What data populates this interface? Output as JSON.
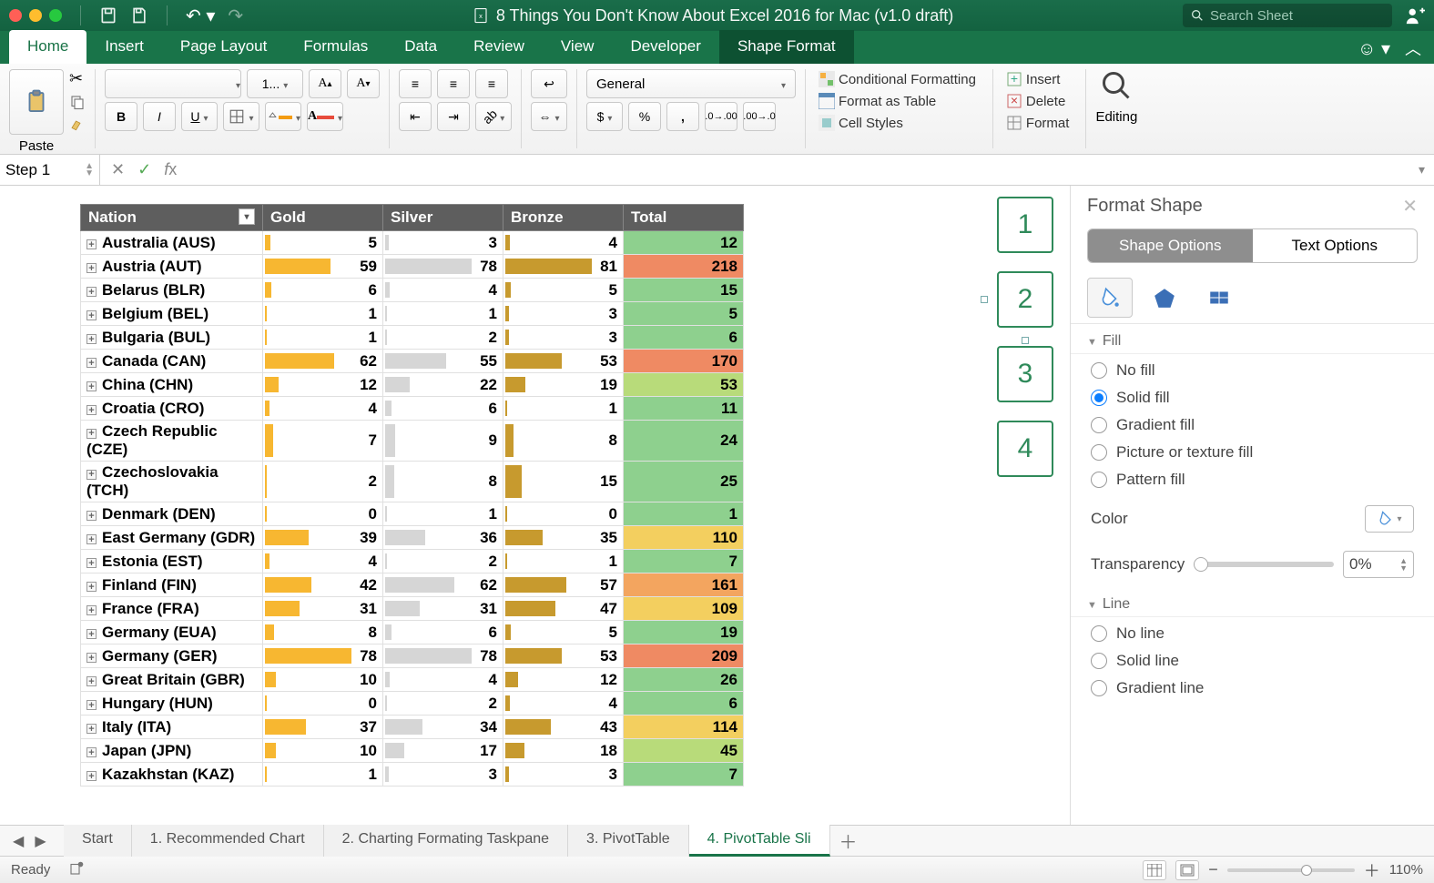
{
  "title": "8 Things You Don't Know About Excel 2016 for Mac (v1.0 draft)",
  "search_placeholder": "Search Sheet",
  "tabs": [
    "Home",
    "Insert",
    "Page Layout",
    "Formulas",
    "Data",
    "Review",
    "View",
    "Developer",
    "Shape Format"
  ],
  "active_tab": "Home",
  "dark_tab": "Shape Format",
  "ribbon": {
    "paste": "Paste",
    "font_name": "",
    "font_size": "1...",
    "number_format": "General",
    "cond_fmt": "Conditional Formatting",
    "fmt_table": "Format as Table",
    "cell_styles": "Cell Styles",
    "insert": "Insert",
    "delete": "Delete",
    "format": "Format",
    "editing": "Editing"
  },
  "namebox": "Step 1",
  "formula": "",
  "pivot": {
    "headers": [
      "Nation",
      "Gold",
      "Silver",
      "Bronze",
      "Total"
    ],
    "max": {
      "gold": 78,
      "silver": 78,
      "bronze": 81
    },
    "rows": [
      {
        "n": "Australia (AUS)",
        "g": 5,
        "s": 3,
        "b": 4,
        "t": 12
      },
      {
        "n": "Austria (AUT)",
        "g": 59,
        "s": 78,
        "b": 81,
        "t": 218
      },
      {
        "n": "Belarus (BLR)",
        "g": 6,
        "s": 4,
        "b": 5,
        "t": 15
      },
      {
        "n": "Belgium (BEL)",
        "g": 1,
        "s": 1,
        "b": 3,
        "t": 5
      },
      {
        "n": "Bulgaria (BUL)",
        "g": 1,
        "s": 2,
        "b": 3,
        "t": 6
      },
      {
        "n": "Canada (CAN)",
        "g": 62,
        "s": 55,
        "b": 53,
        "t": 170
      },
      {
        "n": "China (CHN)",
        "g": 12,
        "s": 22,
        "b": 19,
        "t": 53
      },
      {
        "n": "Croatia (CRO)",
        "g": 4,
        "s": 6,
        "b": 1,
        "t": 11
      },
      {
        "n": "Czech Republic (CZE)",
        "g": 7,
        "s": 9,
        "b": 8,
        "t": 24
      },
      {
        "n": "Czechoslovakia (TCH)",
        "g": 2,
        "s": 8,
        "b": 15,
        "t": 25
      },
      {
        "n": "Denmark (DEN)",
        "g": 0,
        "s": 1,
        "b": 0,
        "t": 1
      },
      {
        "n": "East Germany (GDR)",
        "g": 39,
        "s": 36,
        "b": 35,
        "t": 110
      },
      {
        "n": "Estonia (EST)",
        "g": 4,
        "s": 2,
        "b": 1,
        "t": 7
      },
      {
        "n": "Finland (FIN)",
        "g": 42,
        "s": 62,
        "b": 57,
        "t": 161
      },
      {
        "n": "France (FRA)",
        "g": 31,
        "s": 31,
        "b": 47,
        "t": 109
      },
      {
        "n": "Germany (EUA)",
        "g": 8,
        "s": 6,
        "b": 5,
        "t": 19
      },
      {
        "n": "Germany (GER)",
        "g": 78,
        "s": 78,
        "b": 53,
        "t": 209
      },
      {
        "n": "Great Britain (GBR)",
        "g": 10,
        "s": 4,
        "b": 12,
        "t": 26
      },
      {
        "n": "Hungary (HUN)",
        "g": 0,
        "s": 2,
        "b": 4,
        "t": 6
      },
      {
        "n": "Italy (ITA)",
        "g": 37,
        "s": 34,
        "b": 43,
        "t": 114
      },
      {
        "n": "Japan (JPN)",
        "g": 10,
        "s": 17,
        "b": 18,
        "t": 45
      },
      {
        "n": "Kazakhstan (KAZ)",
        "g": 1,
        "s": 3,
        "b": 3,
        "t": 7
      }
    ]
  },
  "slicer_labels": [
    "1",
    "2",
    "3",
    "4"
  ],
  "panel": {
    "title": "Format Shape",
    "seg": [
      "Shape Options",
      "Text Options"
    ],
    "seg_on": 0,
    "sect_fill": "Fill",
    "fills": [
      "No fill",
      "Solid fill",
      "Gradient fill",
      "Picture or texture fill",
      "Pattern fill"
    ],
    "fill_selected": 1,
    "color_label": "Color",
    "trans_label": "Transparency",
    "trans_value": "0%",
    "sect_line": "Line",
    "lines": [
      "No line",
      "Solid line",
      "Gradient line"
    ]
  },
  "sheet_tabs": [
    "Start",
    "1. Recommended Chart",
    "2. Charting Formating Taskpane",
    "3. PivotTable",
    "4. PivotTable Sli"
  ],
  "sheet_tab_active": 4,
  "status": {
    "left": "Ready",
    "zoom": "110%"
  },
  "chart_data": {
    "type": "table",
    "title": "Olympic medals by nation (pivot with in-cell data bars and total color scale)",
    "columns": [
      "Nation",
      "Gold",
      "Silver",
      "Bronze",
      "Total"
    ],
    "rows": [
      [
        "Australia (AUS)",
        5,
        3,
        4,
        12
      ],
      [
        "Austria (AUT)",
        59,
        78,
        81,
        218
      ],
      [
        "Belarus (BLR)",
        6,
        4,
        5,
        15
      ],
      [
        "Belgium (BEL)",
        1,
        1,
        3,
        5
      ],
      [
        "Bulgaria (BUL)",
        1,
        2,
        3,
        6
      ],
      [
        "Canada (CAN)",
        62,
        55,
        53,
        170
      ],
      [
        "China (CHN)",
        12,
        22,
        19,
        53
      ],
      [
        "Croatia (CRO)",
        4,
        6,
        1,
        11
      ],
      [
        "Czech Republic (CZE)",
        7,
        9,
        8,
        24
      ],
      [
        "Czechoslovakia (TCH)",
        2,
        8,
        15,
        25
      ],
      [
        "Denmark (DEN)",
        0,
        1,
        0,
        1
      ],
      [
        "East Germany (GDR)",
        39,
        36,
        35,
        110
      ],
      [
        "Estonia (EST)",
        4,
        2,
        1,
        7
      ],
      [
        "Finland (FIN)",
        42,
        62,
        57,
        161
      ],
      [
        "France (FRA)",
        31,
        31,
        47,
        109
      ],
      [
        "Germany (EUA)",
        8,
        6,
        5,
        19
      ],
      [
        "Germany (GER)",
        78,
        78,
        53,
        209
      ],
      [
        "Great Britain (GBR)",
        10,
        4,
        12,
        26
      ],
      [
        "Hungary (HUN)",
        0,
        2,
        4,
        6
      ],
      [
        "Italy (ITA)",
        37,
        34,
        43,
        114
      ],
      [
        "Japan (JPN)",
        10,
        17,
        18,
        45
      ],
      [
        "Kazakhstan (KAZ)",
        1,
        3,
        3,
        7
      ]
    ]
  }
}
